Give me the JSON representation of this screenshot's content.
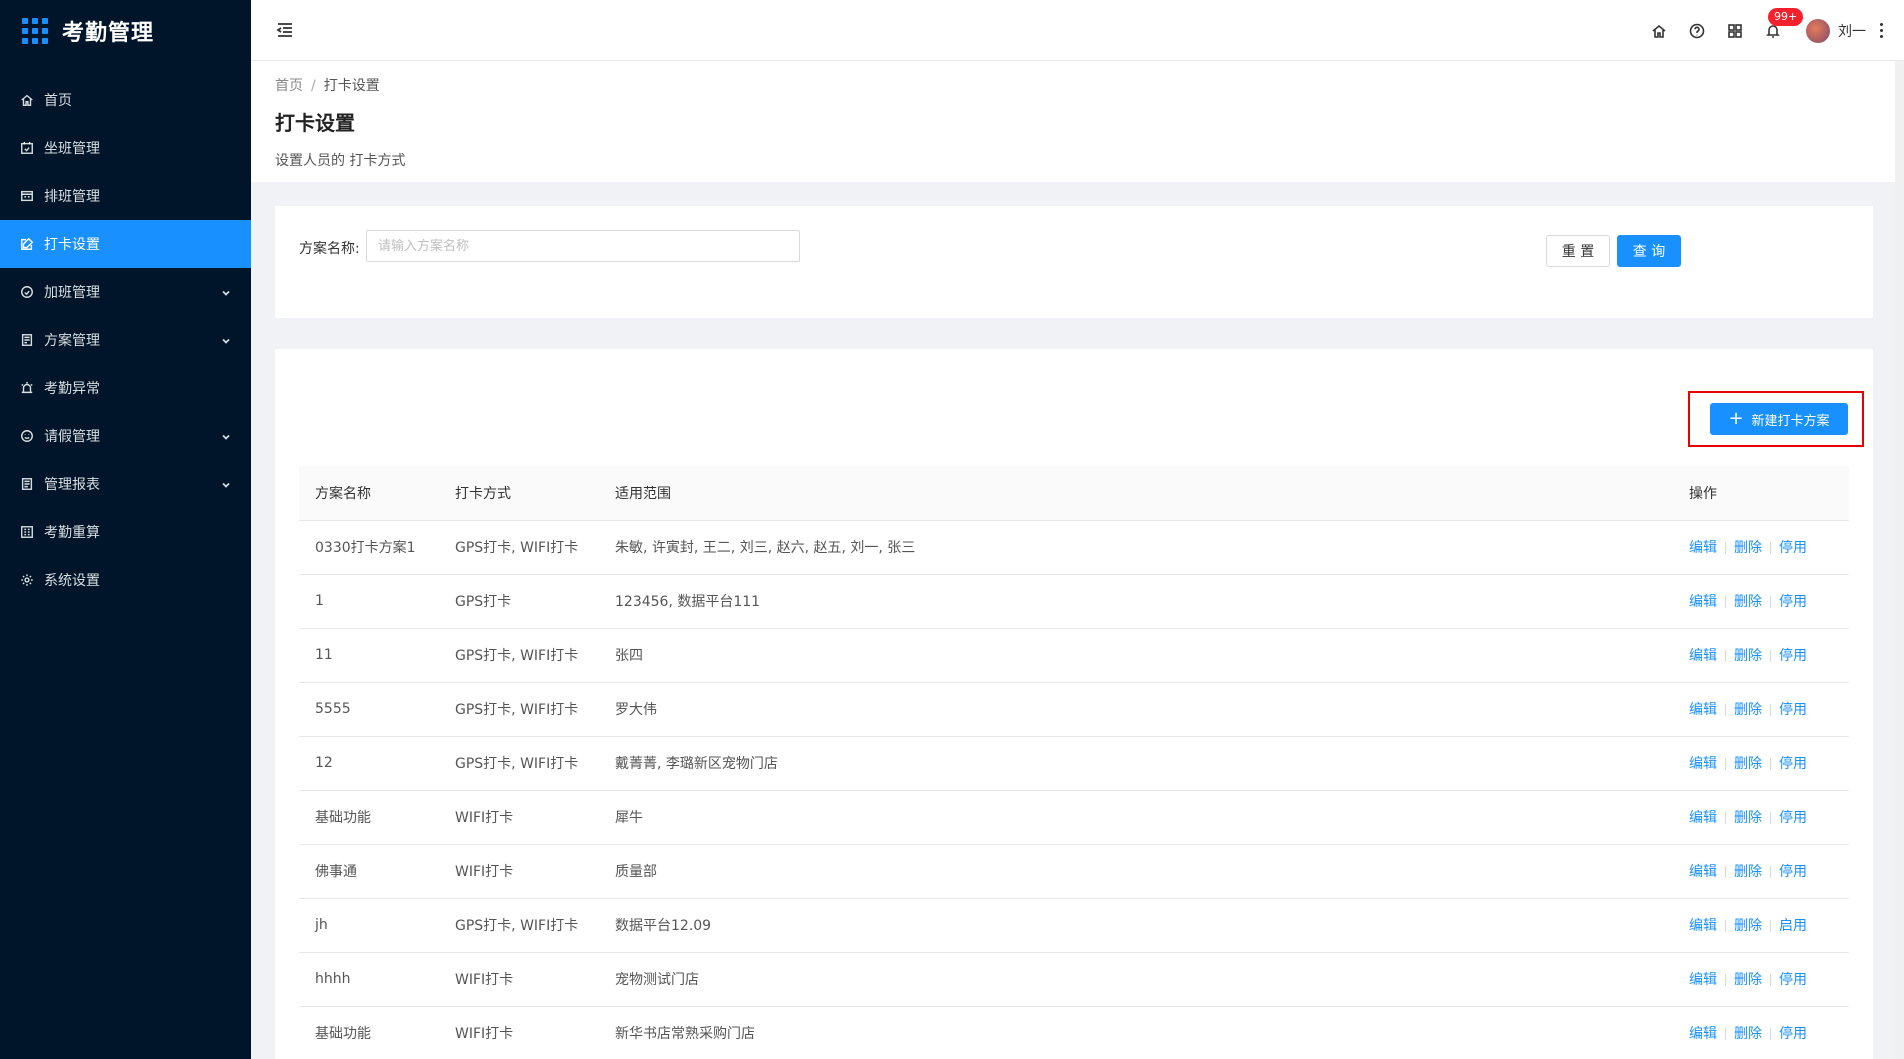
{
  "app": {
    "title": "考勤管理"
  },
  "sidebar": {
    "items": [
      {
        "label": "首页",
        "icon": "home-icon",
        "active": false,
        "expandable": false
      },
      {
        "label": "坐班管理",
        "icon": "calendar-check-icon",
        "active": false,
        "expandable": false
      },
      {
        "label": "排班管理",
        "icon": "schedule-icon",
        "active": false,
        "expandable": false
      },
      {
        "label": "打卡设置",
        "icon": "edit-icon",
        "active": true,
        "expandable": false
      },
      {
        "label": "加班管理",
        "icon": "clock-icon",
        "active": false,
        "expandable": true
      },
      {
        "label": "方案管理",
        "icon": "document-icon",
        "active": false,
        "expandable": true
      },
      {
        "label": "考勤异常",
        "icon": "alarm-icon",
        "active": false,
        "expandable": false
      },
      {
        "label": "请假管理",
        "icon": "smile-icon",
        "active": false,
        "expandable": true
      },
      {
        "label": "管理报表",
        "icon": "report-icon",
        "active": false,
        "expandable": true
      },
      {
        "label": "考勤重算",
        "icon": "calculator-icon",
        "active": false,
        "expandable": false
      },
      {
        "label": "系统设置",
        "icon": "gear-icon",
        "active": false,
        "expandable": false
      }
    ]
  },
  "header": {
    "notification_badge": "99+",
    "user_name": "刘一"
  },
  "breadcrumb": {
    "home": "首页",
    "separator": "/",
    "current": "打卡设置"
  },
  "page": {
    "title": "打卡设置",
    "description": "设置人员的 打卡方式"
  },
  "search": {
    "label": "方案名称:",
    "placeholder": "请输入方案名称",
    "value": "",
    "reset_label": "重 置",
    "query_label": "查 询"
  },
  "toolbar": {
    "new_label": "新建打卡方案"
  },
  "table": {
    "columns": [
      "方案名称",
      "打卡方式",
      "适用范围",
      "操作"
    ],
    "rows": [
      {
        "name": "0330打卡方案1",
        "method": "GPS打卡, WIFI打卡",
        "scope": "朱敏, 许寅封, 王二, 刘三, 赵六, 赵五, 刘一, 张三",
        "ops": [
          "编辑",
          "删除",
          "停用"
        ]
      },
      {
        "name": "1",
        "method": "GPS打卡",
        "scope": "123456, 数据平台111",
        "ops": [
          "编辑",
          "删除",
          "停用"
        ]
      },
      {
        "name": "11",
        "method": "GPS打卡, WIFI打卡",
        "scope": "张四",
        "ops": [
          "编辑",
          "删除",
          "停用"
        ]
      },
      {
        "name": "5555",
        "method": "GPS打卡, WIFI打卡",
        "scope": "罗大伟",
        "ops": [
          "编辑",
          "删除",
          "停用"
        ]
      },
      {
        "name": "12",
        "method": "GPS打卡, WIFI打卡",
        "scope": "戴菁菁, 李璐新区宠物门店",
        "ops": [
          "编辑",
          "删除",
          "停用"
        ]
      },
      {
        "name": "基础功能",
        "method": "WIFI打卡",
        "scope": "犀牛",
        "ops": [
          "编辑",
          "删除",
          "停用"
        ]
      },
      {
        "name": "佛事通",
        "method": "WIFI打卡",
        "scope": "质量部",
        "ops": [
          "编辑",
          "删除",
          "停用"
        ]
      },
      {
        "name": "jh",
        "method": "GPS打卡, WIFI打卡",
        "scope": "数据平台12.09",
        "ops": [
          "编辑",
          "删除",
          "启用"
        ]
      },
      {
        "name": "hhhh",
        "method": "WIFI打卡",
        "scope": "宠物测试门店",
        "ops": [
          "编辑",
          "删除",
          "停用"
        ]
      },
      {
        "name": "基础功能",
        "method": "WIFI打卡",
        "scope": "新华书店常熟采购门店",
        "ops": [
          "编辑",
          "删除",
          "停用"
        ]
      }
    ]
  },
  "colors": {
    "primary": "#1890ff",
    "sidebar_bg": "#001529",
    "highlight": "#e60000",
    "badge": "#f5222d"
  }
}
